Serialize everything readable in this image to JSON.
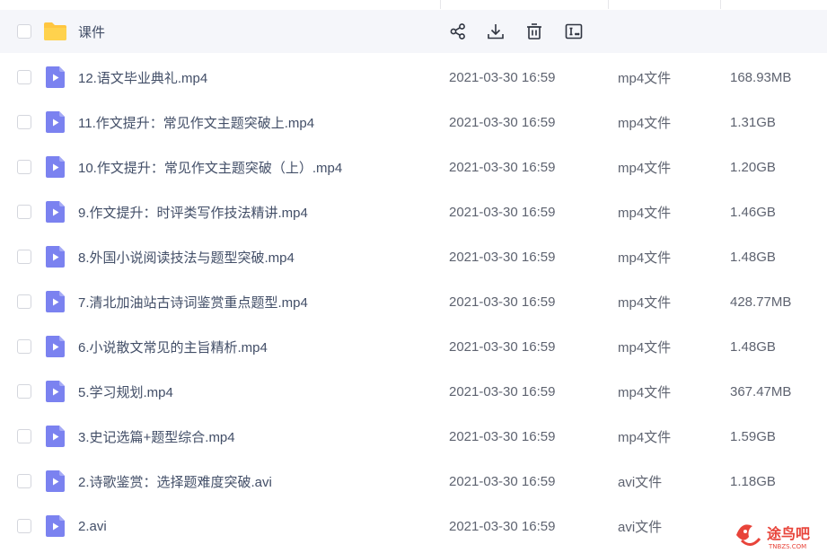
{
  "folder": {
    "name": "课件",
    "actions": [
      "share-icon",
      "download-icon",
      "delete-icon",
      "rename-icon"
    ]
  },
  "files": [
    {
      "name": "12.语文毕业典礼.mp4",
      "date": "2021-03-30 16:59",
      "type": "mp4文件",
      "size": "168.93MB"
    },
    {
      "name": "11.作文提升：常见作文主题突破上.mp4",
      "date": "2021-03-30 16:59",
      "type": "mp4文件",
      "size": "1.31GB"
    },
    {
      "name": "10.作文提升：常见作文主题突破（上）.mp4",
      "date": "2021-03-30 16:59",
      "type": "mp4文件",
      "size": "1.20GB"
    },
    {
      "name": "9.作文提升：时评类写作技法精讲.mp4",
      "date": "2021-03-30 16:59",
      "type": "mp4文件",
      "size": "1.46GB"
    },
    {
      "name": "8.外国小说阅读技法与题型突破.mp4",
      "date": "2021-03-30 16:59",
      "type": "mp4文件",
      "size": "1.48GB"
    },
    {
      "name": "7.清北加油站古诗词鉴赏重点题型.mp4",
      "date": "2021-03-30 16:59",
      "type": "mp4文件",
      "size": "428.77MB"
    },
    {
      "name": "6.小说散文常见的主旨精析.mp4",
      "date": "2021-03-30 16:59",
      "type": "mp4文件",
      "size": "1.48GB"
    },
    {
      "name": "5.学习规划.mp4",
      "date": "2021-03-30 16:59",
      "type": "mp4文件",
      "size": "367.47MB"
    },
    {
      "name": "3.史记选篇+题型综合.mp4",
      "date": "2021-03-30 16:59",
      "type": "mp4文件",
      "size": "1.59GB"
    },
    {
      "name": "2.诗歌鉴赏：选择题难度突破.avi",
      "date": "2021-03-30 16:59",
      "type": "avi文件",
      "size": "1.18GB"
    },
    {
      "name": "2.avi",
      "date": "2021-03-30 16:59",
      "type": "avi文件",
      "size": ""
    }
  ],
  "watermark": {
    "text": "途鸟吧",
    "subtext": "TNBZS.COM"
  },
  "colors": {
    "accent": "#7b82f0",
    "folder": "#ffc640",
    "watermark": "#e8443a"
  }
}
